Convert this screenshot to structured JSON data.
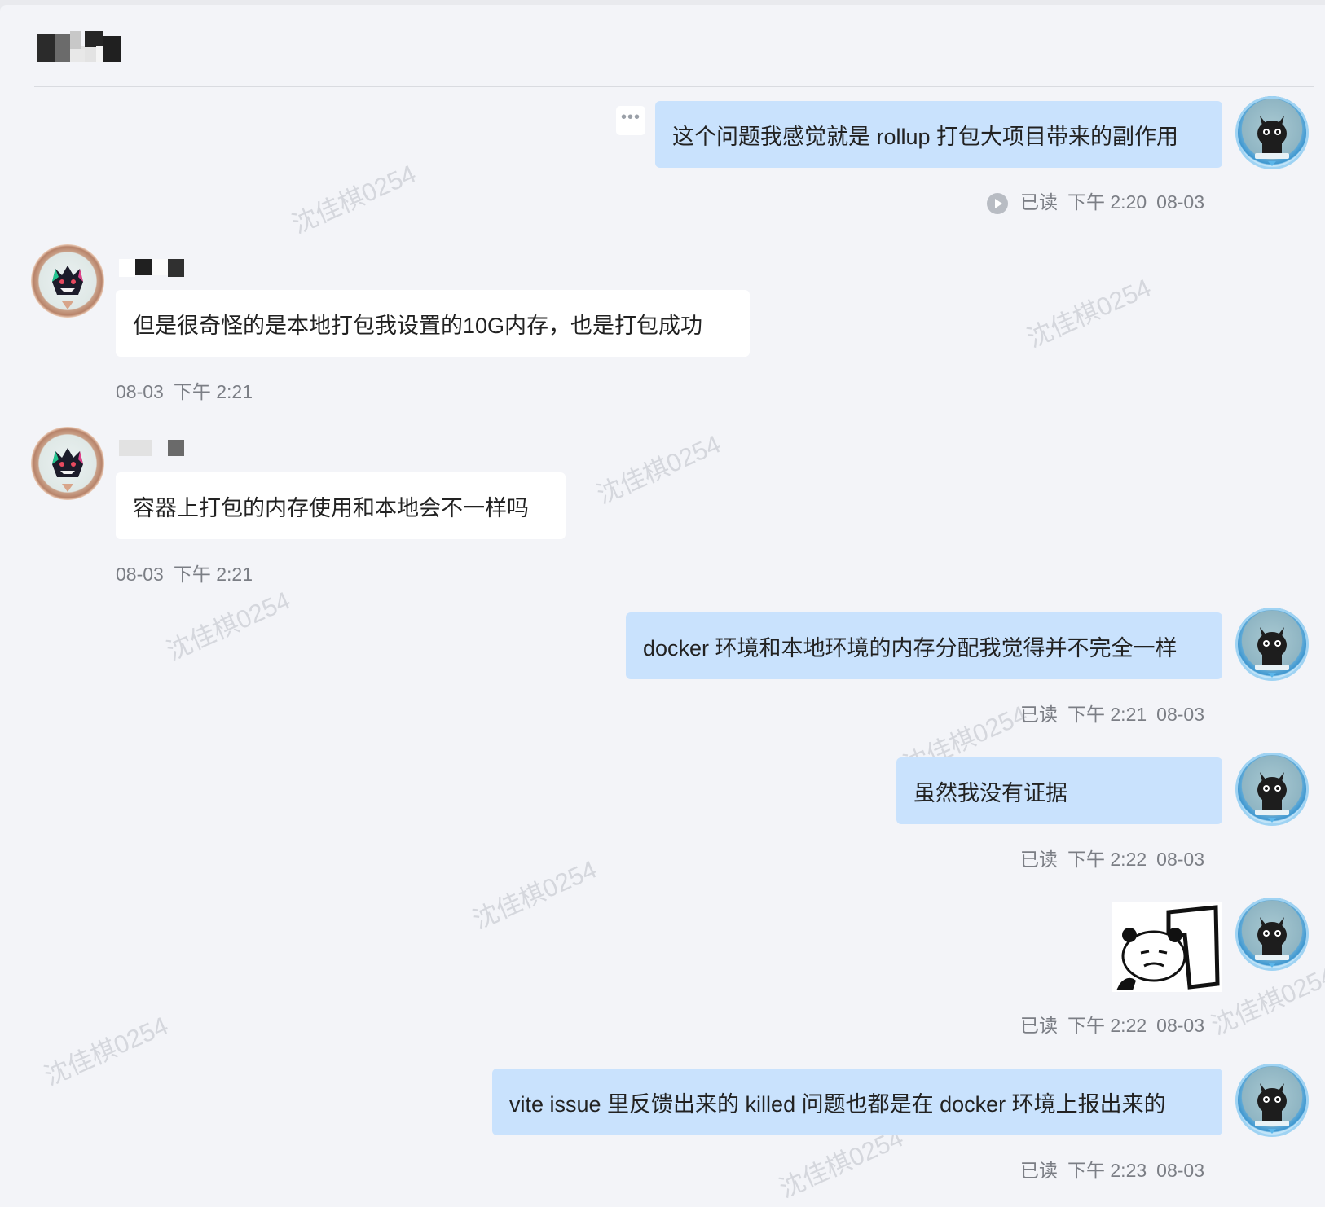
{
  "header": {
    "title": ""
  },
  "watermark_text": "沈佳棋0254",
  "messages": [
    {
      "text": "这个问题我感觉就是 rollup 打包大项目带来的副作用",
      "read": "已读",
      "time": "下午 2:20",
      "date": "08-03"
    },
    {
      "text": "但是很奇怪的是本地打包我设置的10G内存，也是打包成功",
      "date": "08-03",
      "time": "下午 2:21"
    },
    {
      "text": "容器上打包的内存使用和本地会不一样吗",
      "date": "08-03",
      "time": "下午 2:21"
    },
    {
      "text": "docker 环境和本地环境的内存分配我觉得并不完全一样",
      "read": "已读",
      "time": "下午 2:21",
      "date": "08-03"
    },
    {
      "text": "虽然我没有证据",
      "read": "已读",
      "time": "下午 2:22",
      "date": "08-03"
    },
    {
      "read": "已读",
      "time": "下午 2:22",
      "date": "08-03"
    },
    {
      "text": "vite issue 里反馈出来的 killed 问题也都是在 docker 环境上报出来的",
      "read": "已读",
      "time": "下午 2:23",
      "date": "08-03"
    }
  ],
  "icons": {
    "more": "more-dots-icon",
    "read_receipt": "play-circle-icon",
    "my_avatar": "black-cat-avatar",
    "other_avatar": "ghost-avatar"
  },
  "colors": {
    "outgoing_bubble": "#c9e2fd",
    "incoming_bubble": "#ffffff",
    "background": "#f3f4f8"
  }
}
